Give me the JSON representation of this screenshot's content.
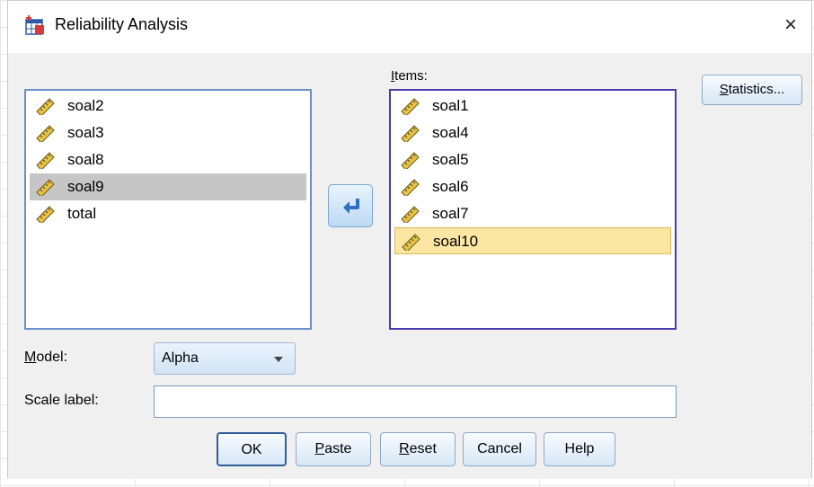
{
  "window": {
    "title": "Reliability Analysis",
    "close_glyph": "×",
    "icon": "spss-table-icon"
  },
  "source_list": {
    "items": [
      "soal2",
      "soal3",
      "soal8",
      "soal9",
      "total"
    ],
    "selected_index": 3
  },
  "items_list": {
    "label_mnemonic": "I",
    "label_rest": "tems:",
    "items": [
      "soal1",
      "soal4",
      "soal5",
      "soal6",
      "soal7",
      "soal10"
    ],
    "selected_index": 5
  },
  "buttons": {
    "statistics_mnemonic": "S",
    "statistics_rest": "tatistics...",
    "ok": "OK",
    "paste_mnemonic": "P",
    "paste_rest": "aste",
    "reset_mnemonic": "R",
    "reset_rest": "eset",
    "cancel": "Cancel",
    "help": "Help",
    "move_arrow_icon": "arrow-left-icon"
  },
  "model": {
    "label_mnemonic": "M",
    "label_rest": "odel:",
    "value": "Alpha"
  },
  "scale_label": {
    "label": "Scale label:",
    "value": ""
  },
  "colors": {
    "dialog_bg": "#f0f0f0",
    "selected_gray": "#c6c6c6",
    "selected_yellow": "#fbe6a2",
    "items_border": "#4a3db0"
  }
}
